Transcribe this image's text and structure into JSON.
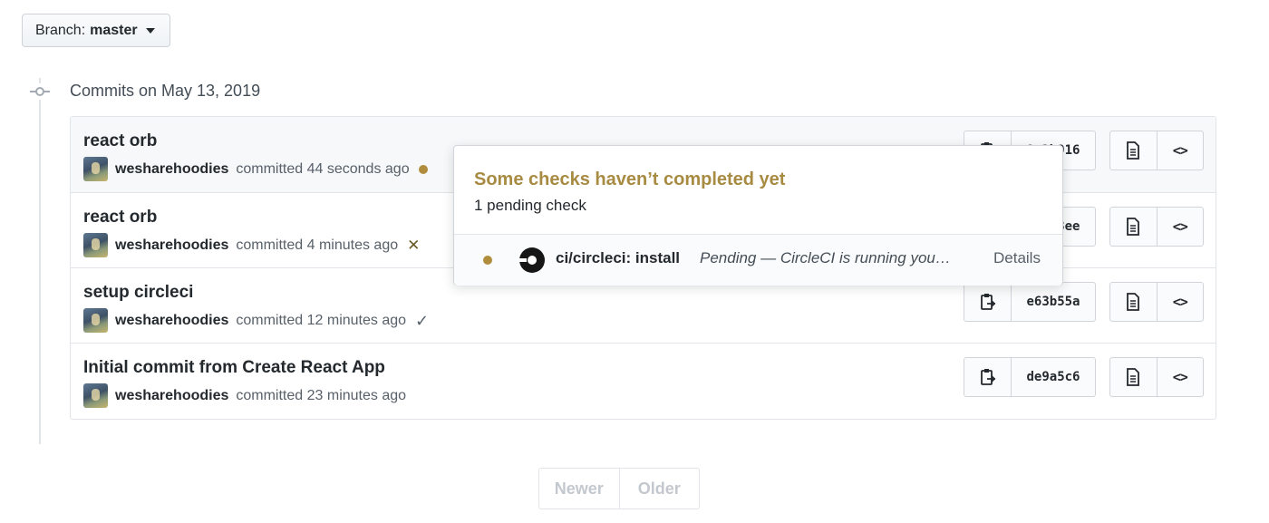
{
  "branch": {
    "label": "Branch:",
    "value": "master"
  },
  "group": {
    "title": "Commits on May 13, 2019"
  },
  "commits": [
    {
      "title": "react orb",
      "author": "wesharehoodies",
      "time": "committed 44 seconds ago",
      "status": "pending",
      "sha": "9a2b916"
    },
    {
      "title": "react orb",
      "author": "wesharehoodies",
      "time": "committed 4 minutes ago",
      "status": "failure",
      "sha": "5c1e3ee"
    },
    {
      "title": "setup circleci",
      "author": "wesharehoodies",
      "time": "committed 12 minutes ago",
      "status": "success",
      "sha": "e63b55a"
    },
    {
      "title": "Initial commit from Create React App",
      "author": "wesharehoodies",
      "time": "committed 23 minutes ago",
      "status": "none",
      "sha": "de9a5c6"
    }
  ],
  "popover": {
    "title": "Some checks haven’t completed yet",
    "subtitle": "1 pending check",
    "check": {
      "name": "ci/circleci: install",
      "description": "Pending — CircleCI is running your tests",
      "link": "Details"
    }
  },
  "pagination": {
    "newer": "Newer",
    "older": "Older"
  },
  "colors": {
    "pending": "#b08d3c",
    "title_pending": "#a88b42",
    "border": "#e1e4e8"
  }
}
